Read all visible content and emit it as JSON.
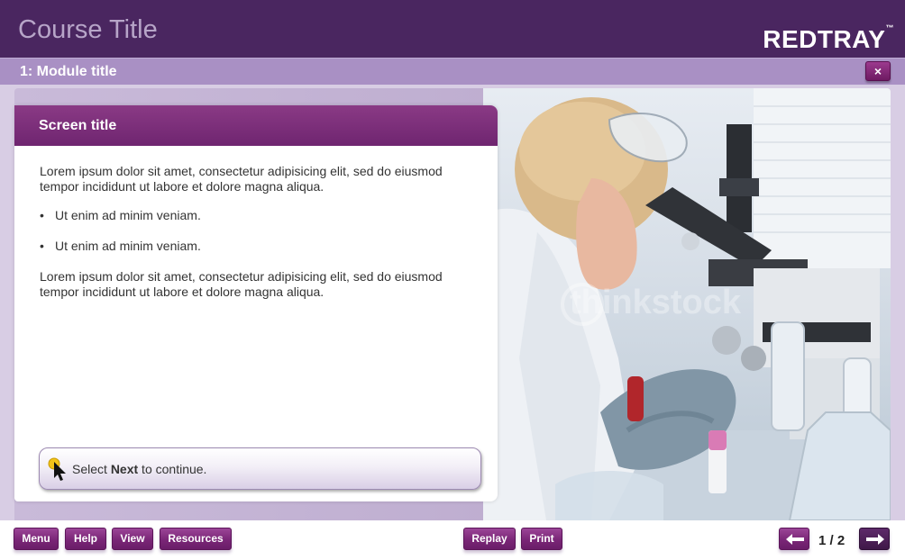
{
  "header": {
    "course_title": "Course Title",
    "logo_text": "REDTRAY",
    "logo_tm": "™"
  },
  "module_bar": {
    "module_title": "1: Module title",
    "close_label": "×"
  },
  "panel": {
    "screen_title": "Screen title",
    "paragraph1": "Lorem ipsum dolor sit amet, consectetur adipisicing elit, sed do eiusmod tempor incididunt ut labore et dolore magna aliqua.",
    "bullets": [
      "Ut enim ad minim veniam.",
      "Ut enim ad minim veniam."
    ],
    "paragraph2": "Lorem ipsum dolor sit amet, consectetur adipisicing elit, sed do eiusmod tempor incididunt ut labore et dolore magna aliqua.",
    "instruction": {
      "prefix": "Select ",
      "bold": "Next",
      "suffix": " to continue."
    }
  },
  "photo": {
    "watermark": "thinkstock"
  },
  "footer": {
    "buttons_left": [
      "Menu",
      "Help",
      "View",
      "Resources"
    ],
    "buttons_center": [
      "Replay",
      "Print"
    ],
    "page_indicator": "1 / 2",
    "prev_icon": "arrow-left-icon",
    "next_icon": "arrow-right-icon"
  },
  "colors": {
    "header_bg": "#4a2660",
    "module_bar_bg": "#a990c4",
    "accent": "#7a2677"
  }
}
